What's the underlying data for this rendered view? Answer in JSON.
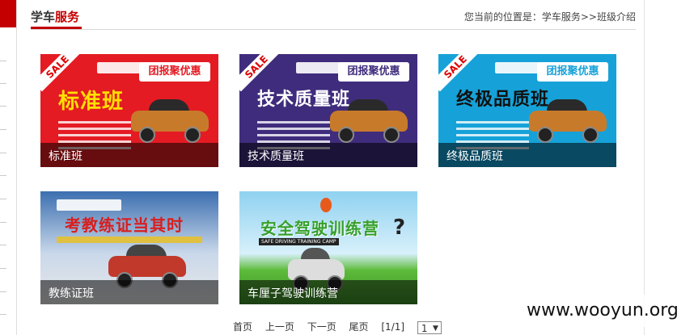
{
  "header": {
    "title_black": "学车",
    "title_red": "服务",
    "breadcrumb": "您当前的位置是：学车服务>>班级介绍"
  },
  "cards": [
    {
      "caption": "标准班",
      "headline": "标准班",
      "tag": "团报聚优惠",
      "sale": "SALE",
      "bg": "#e41b23",
      "accent": "#ffe000"
    },
    {
      "caption": "技术质量班",
      "headline": "技术质量班",
      "tag": "团报聚优惠",
      "sale": "SALE",
      "bg": "#3f2c7c",
      "accent": "#ffffff"
    },
    {
      "caption": "终极品质班",
      "headline": "终极品质班",
      "tag": "团报聚优惠",
      "sale": "SALE",
      "bg": "#16a2d8",
      "accent": "#111111"
    },
    {
      "caption": "教练证班",
      "headline": "考教练证当其时",
      "bg": "#3c6fb0",
      "accent": "#d81e1e"
    },
    {
      "caption": "车厘子驾驶训练营",
      "headline": "安全驾驶训练营",
      "sub": "SAFE DRIVING TRAINING CAMP",
      "bg": "#8fd2f0",
      "accent": "#36a02c"
    }
  ],
  "pager": {
    "first": "首页",
    "prev": "上一页",
    "next": "下一页",
    "last": "尾页",
    "info": "[1/1]",
    "select_value": "1",
    "select_arrow": "▼"
  },
  "watermark": "www.wooyun.org"
}
